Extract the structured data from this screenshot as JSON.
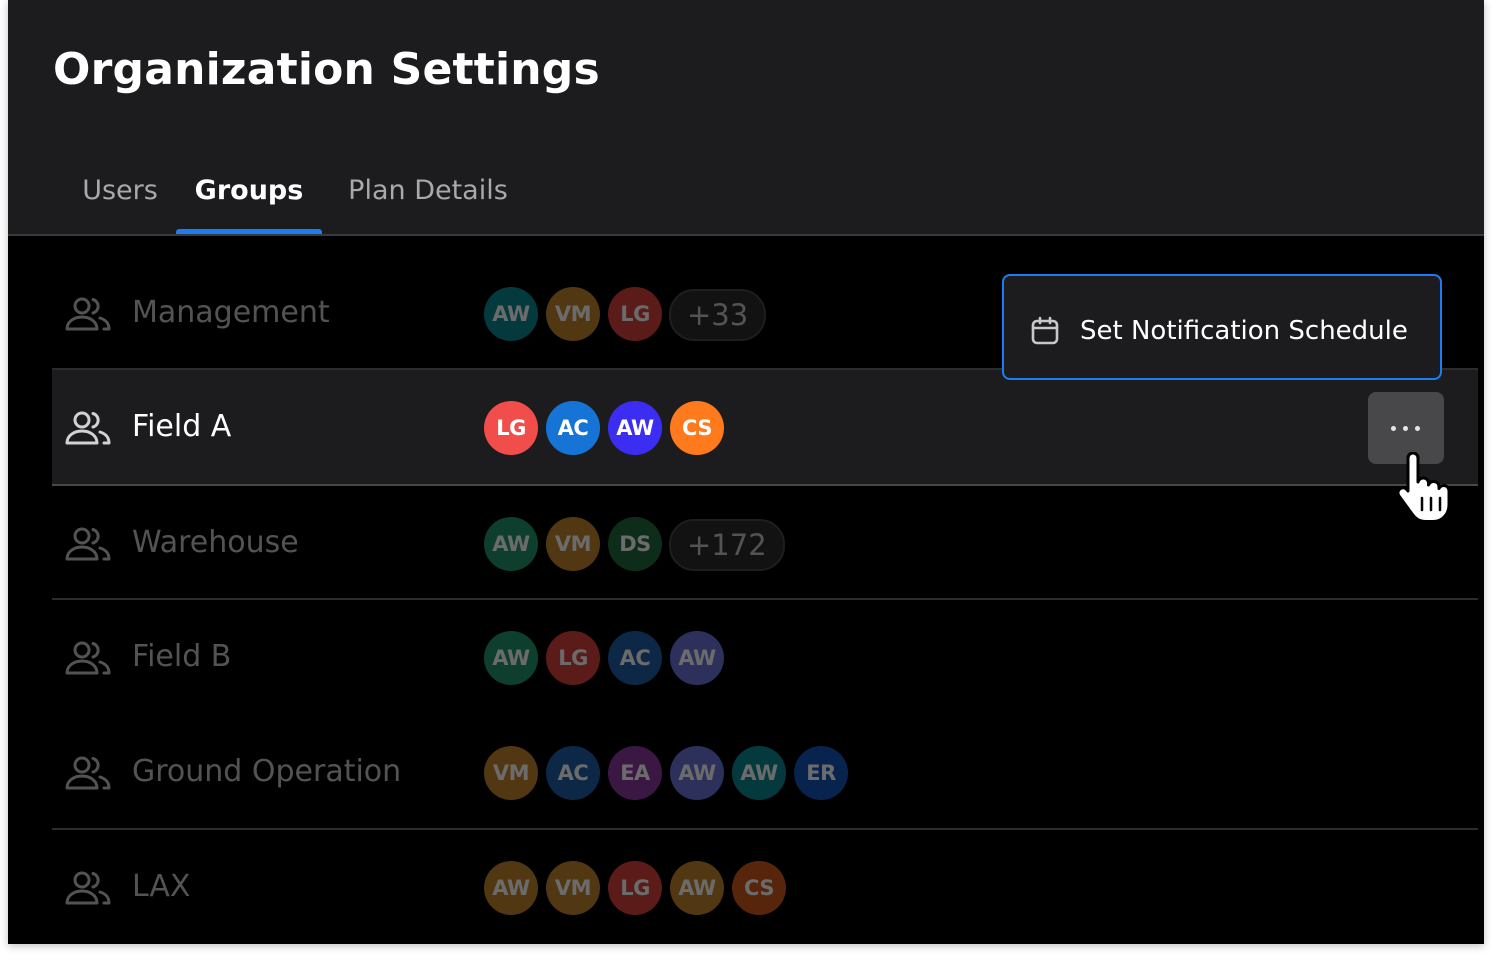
{
  "page": {
    "title": "Organization Settings"
  },
  "tabs": [
    {
      "label": "Users"
    },
    {
      "label": "Groups",
      "active": true
    },
    {
      "label": "Plan Details"
    }
  ],
  "groups": [
    {
      "name": "Management",
      "avatars": [
        {
          "initials": "AW",
          "color": "#0b8a95"
        },
        {
          "initials": "VM",
          "color": "#c1852e"
        },
        {
          "initials": "LG",
          "color": "#d8403a"
        }
      ],
      "more": "+33"
    },
    {
      "name": "Field A",
      "avatars": [
        {
          "initials": "LG",
          "color": "#f04d4b"
        },
        {
          "initials": "AC",
          "color": "#1674d6"
        },
        {
          "initials": "AW",
          "color": "#3b2ef2"
        },
        {
          "initials": "CS",
          "color": "#ff7a1c"
        }
      ]
    },
    {
      "name": "Warehouse",
      "avatars": [
        {
          "initials": "AW",
          "color": "#23976e"
        },
        {
          "initials": "VM",
          "color": "#c1852e"
        },
        {
          "initials": "DS",
          "color": "#1f6b3e"
        }
      ],
      "more": "+172"
    },
    {
      "name": "Field B",
      "avatars": [
        {
          "initials": "AW",
          "color": "#23976e"
        },
        {
          "initials": "LG",
          "color": "#d8403a"
        },
        {
          "initials": "AC",
          "color": "#1d5fa8"
        },
        {
          "initials": "AW",
          "color": "#6b74d8"
        }
      ]
    },
    {
      "name": "Ground Operation",
      "avatars": [
        {
          "initials": "VM",
          "color": "#c1852e"
        },
        {
          "initials": "AC",
          "color": "#1d5fa8"
        },
        {
          "initials": "EA",
          "color": "#8b3aa0"
        },
        {
          "initials": "AW",
          "color": "#6b74d8"
        },
        {
          "initials": "AW",
          "color": "#0b8a95"
        },
        {
          "initials": "ER",
          "color": "#1453b8"
        }
      ]
    },
    {
      "name": "LAX",
      "avatars": [
        {
          "initials": "AW",
          "color": "#c1852e"
        },
        {
          "initials": "VM",
          "color": "#c1852e"
        },
        {
          "initials": "LG",
          "color": "#d8403a"
        },
        {
          "initials": "AW",
          "color": "#c1852e"
        },
        {
          "initials": "CS",
          "color": "#cc5a1e"
        }
      ]
    }
  ],
  "context_menu": {
    "items": [
      {
        "label": "Set Notification Schedule",
        "icon": "calendar-icon"
      }
    ]
  },
  "icons": {
    "group": "users-group-icon",
    "row_menu": "more-horizontal-icon",
    "pointer": "hand-pointer-icon"
  },
  "colors": {
    "accent": "#1e7cf2",
    "header_bg": "#1c1c1e",
    "list_bg": "#000000",
    "selected_row_bg": "#1c1c1e"
  }
}
